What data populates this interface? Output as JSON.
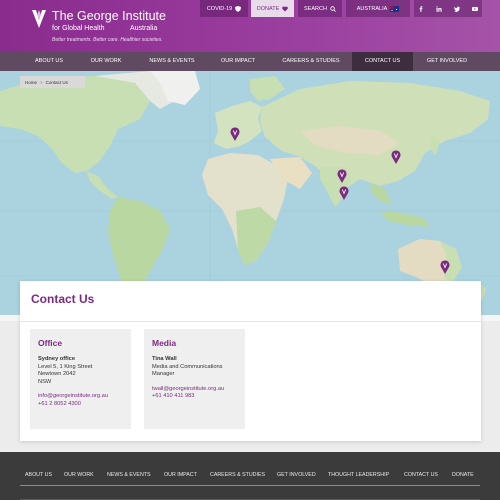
{
  "brand": {
    "title": "The George Institute",
    "subtitle": "for Global Health",
    "country": "Australia",
    "tagline": "Better treatments. Better care. Healthier societies."
  },
  "utility": {
    "covid": "COVID-19",
    "donate": "DONATE",
    "search": "SEARCH",
    "country": "AUSTRALIA"
  },
  "nav": {
    "items": [
      "ABOUT US",
      "OUR WORK",
      "NEWS & EVENTS",
      "OUR IMPACT",
      "CAREERS & STUDIES",
      "CONTACT US",
      "GET INVOLVED"
    ],
    "active": "CONTACT US"
  },
  "breadcrumb": {
    "home": "Home",
    "sep": ">",
    "current": "Contact Us"
  },
  "contact": {
    "title": "Contact Us",
    "office": {
      "heading": "Office",
      "name": "Sydney office",
      "line1": "Level 5, 1 King Street",
      "line2": "Newtown 2042",
      "line3": "NSW",
      "email": "info@georgeinstitute.org.au",
      "phone": "+61 2 8052 4300"
    },
    "media": {
      "heading": "Media",
      "name": "Tina Wall",
      "role1": "Media and Communications",
      "role2": "Manager",
      "email": "twall@georgeinstitute.org.au",
      "phone": "+61 410 411 983"
    }
  },
  "footer": {
    "items": [
      "ABOUT US",
      "OUR WORK",
      "NEWS & EVENTS",
      "OUR IMPACT",
      "CAREERS & STUDIES",
      "GET INVOLVED",
      "THOUGHT LEADERSHIP",
      "CONTACT US",
      "DONATE"
    ]
  },
  "colors": {
    "brand": "#8a2b8e",
    "nav": "#5f4a61",
    "nav_active": "#3e2d3f",
    "accent": "#7b2a80",
    "footer": "#3b3b3b",
    "ocean": "#aad3df",
    "land": "#c7dfb3"
  },
  "icons": [
    "logo-icon",
    "shield-icon",
    "heart-icon",
    "search-icon",
    "flag-icon",
    "facebook-icon",
    "linkedin-icon",
    "twitter-icon",
    "youtube-icon",
    "map-pin-icon"
  ]
}
